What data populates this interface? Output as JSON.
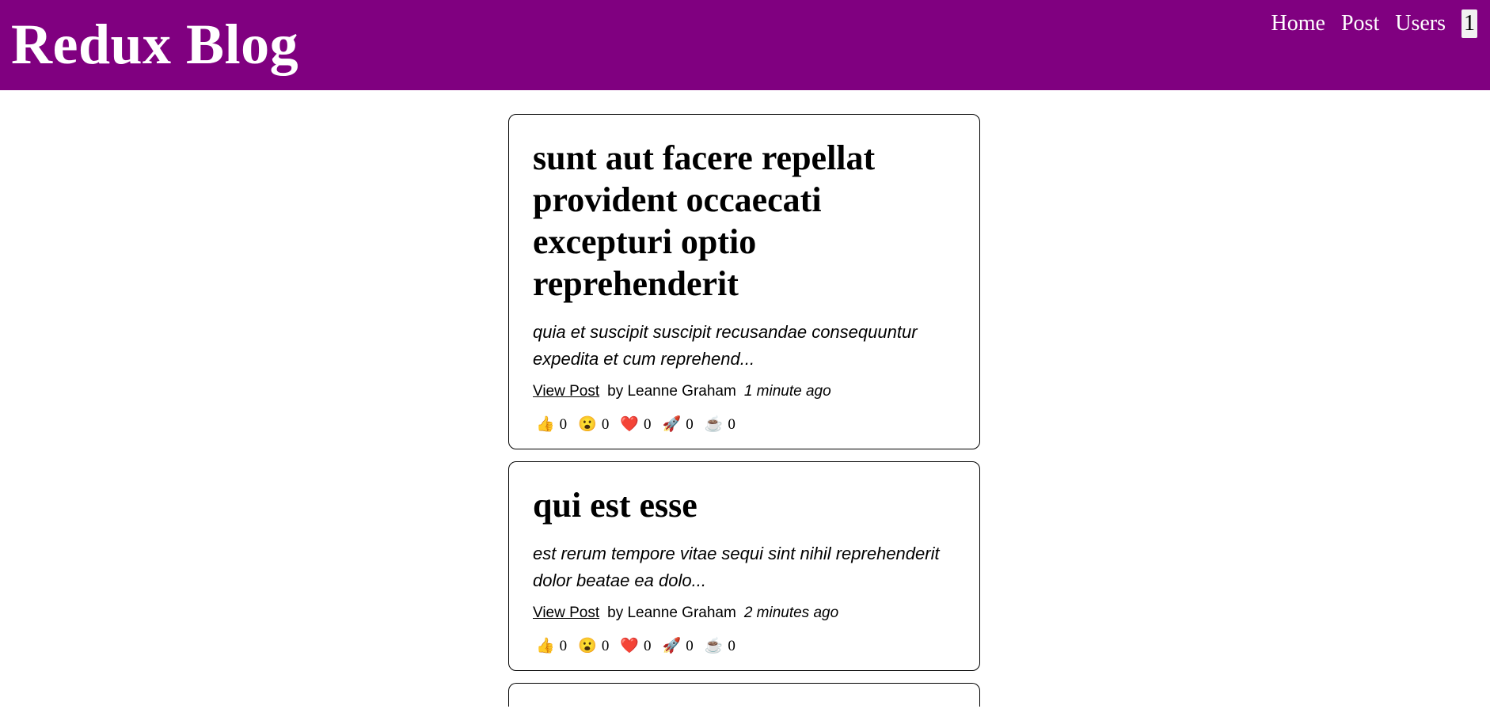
{
  "header": {
    "brand": "Redux Blog",
    "nav": [
      "Home",
      "Post",
      "Users"
    ],
    "count": "1"
  },
  "posts": [
    {
      "title": "sunt aut facere repellat provident occaecati excepturi optio reprehenderit",
      "excerpt": "quia et suscipit suscipit recusandae consequuntur expedita et cum reprehend...",
      "view_label": "View Post",
      "author": "by Leanne Graham",
      "time": "1 minute ago",
      "reactions": [
        {
          "emoji": "👍",
          "count": "0"
        },
        {
          "emoji": "😮",
          "count": "0"
        },
        {
          "emoji": "❤️",
          "count": "0"
        },
        {
          "emoji": "🚀",
          "count": "0"
        },
        {
          "emoji": "☕",
          "count": "0"
        }
      ]
    },
    {
      "title": "qui est esse",
      "excerpt": "est rerum tempore vitae sequi sint nihil reprehenderit dolor beatae ea dolo...",
      "view_label": "View Post",
      "author": "by Leanne Graham",
      "time": "2 minutes ago",
      "reactions": [
        {
          "emoji": "👍",
          "count": "0"
        },
        {
          "emoji": "😮",
          "count": "0"
        },
        {
          "emoji": "❤️",
          "count": "0"
        },
        {
          "emoji": "🚀",
          "count": "0"
        },
        {
          "emoji": "☕",
          "count": "0"
        }
      ]
    }
  ]
}
